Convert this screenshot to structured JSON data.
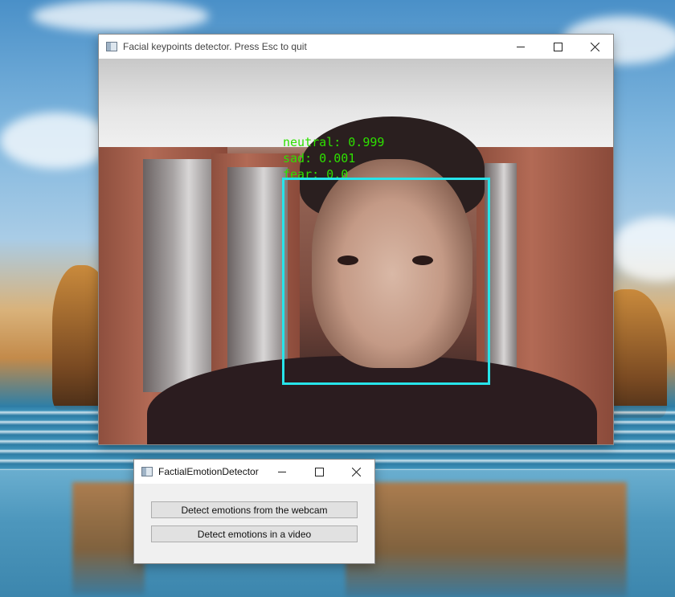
{
  "video_window": {
    "title": "Facial keypoints detector. Press Esc to quit",
    "emotions": [
      {
        "label": "neutral: 0.999"
      },
      {
        "label": "sad: 0.001"
      },
      {
        "label": "fear: 0.0"
      }
    ],
    "face_box_color": "#27e4ea",
    "label_color": "#2ee000"
  },
  "dialog": {
    "title": "FactialEmotionDetector",
    "buttons": {
      "webcam": "Detect emotions from the webcam",
      "video": "Detect emotions in a video"
    }
  },
  "caption_icons": [
    "minimize-icon",
    "maximize-icon",
    "close-icon"
  ]
}
